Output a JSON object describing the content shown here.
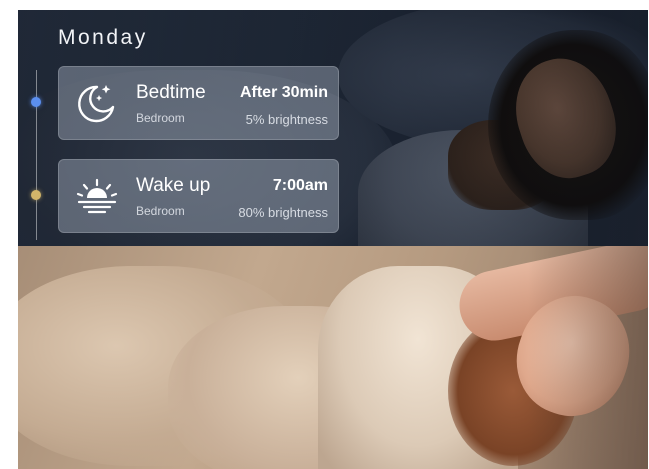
{
  "day": "Monday",
  "schedule": [
    {
      "name": "Bedtime",
      "room": "Bedroom",
      "time": "After 30min",
      "brightness": "5% brightness",
      "icon": "moon-stars-icon",
      "dot_color": "#5b8ff0"
    },
    {
      "name": "Wake up",
      "room": "Bedroom",
      "time": "7:00am",
      "brightness": "80% brightness",
      "icon": "sunrise-icon",
      "dot_color": "#d2b56a"
    }
  ]
}
